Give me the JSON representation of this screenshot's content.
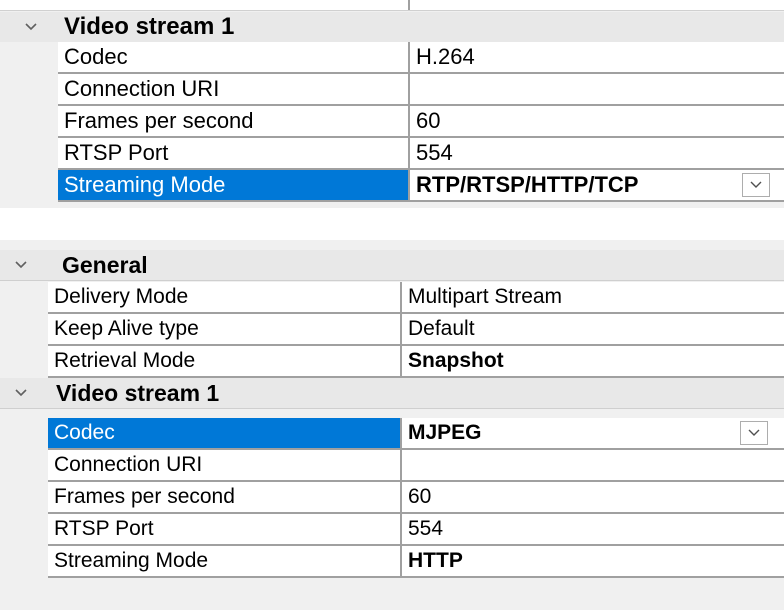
{
  "colors": {
    "selection": "#0078d7",
    "grid_line": "#a0a0a0",
    "category_bg": "#e8e8e8",
    "panel_bg": "#f0f0f0"
  },
  "panel1": {
    "category": {
      "title": "Video stream 1",
      "expanded": true,
      "icon": "chevron-down-icon"
    },
    "rows": [
      {
        "name": "Codec",
        "value": "H.264",
        "bold": false,
        "selected": false
      },
      {
        "name": "Connection URI",
        "value": "",
        "bold": false,
        "selected": false
      },
      {
        "name": "Frames per second",
        "value": "60",
        "bold": false,
        "selected": false
      },
      {
        "name": "RTSP Port",
        "value": "554",
        "bold": false,
        "selected": false
      },
      {
        "name": "Streaming Mode",
        "value": "RTP/RTSP/HTTP/TCP",
        "bold": true,
        "selected": true,
        "dropdown": true
      }
    ]
  },
  "panel2": {
    "general": {
      "title": "General",
      "expanded": true,
      "icon": "chevron-down-icon",
      "rows": [
        {
          "name": "Delivery Mode",
          "value": "Multipart Stream",
          "bold": false,
          "selected": false
        },
        {
          "name": "Keep Alive type",
          "value": "Default",
          "bold": false,
          "selected": false
        },
        {
          "name": "Retrieval Mode",
          "value": "Snapshot",
          "bold": true,
          "selected": false
        }
      ]
    },
    "video_stream": {
      "title": "Video stream 1",
      "expanded": true,
      "icon": "chevron-down-icon",
      "rows": [
        {
          "name": "Codec",
          "value": "MJPEG",
          "bold": true,
          "selected": true,
          "dropdown": true
        },
        {
          "name": "Connection URI",
          "value": "",
          "bold": false,
          "selected": false
        },
        {
          "name": "Frames per second",
          "value": "60",
          "bold": false,
          "selected": false
        },
        {
          "name": "RTSP Port",
          "value": "554",
          "bold": false,
          "selected": false
        },
        {
          "name": "Streaming Mode",
          "value": "HTTP",
          "bold": true,
          "selected": false
        }
      ]
    }
  }
}
